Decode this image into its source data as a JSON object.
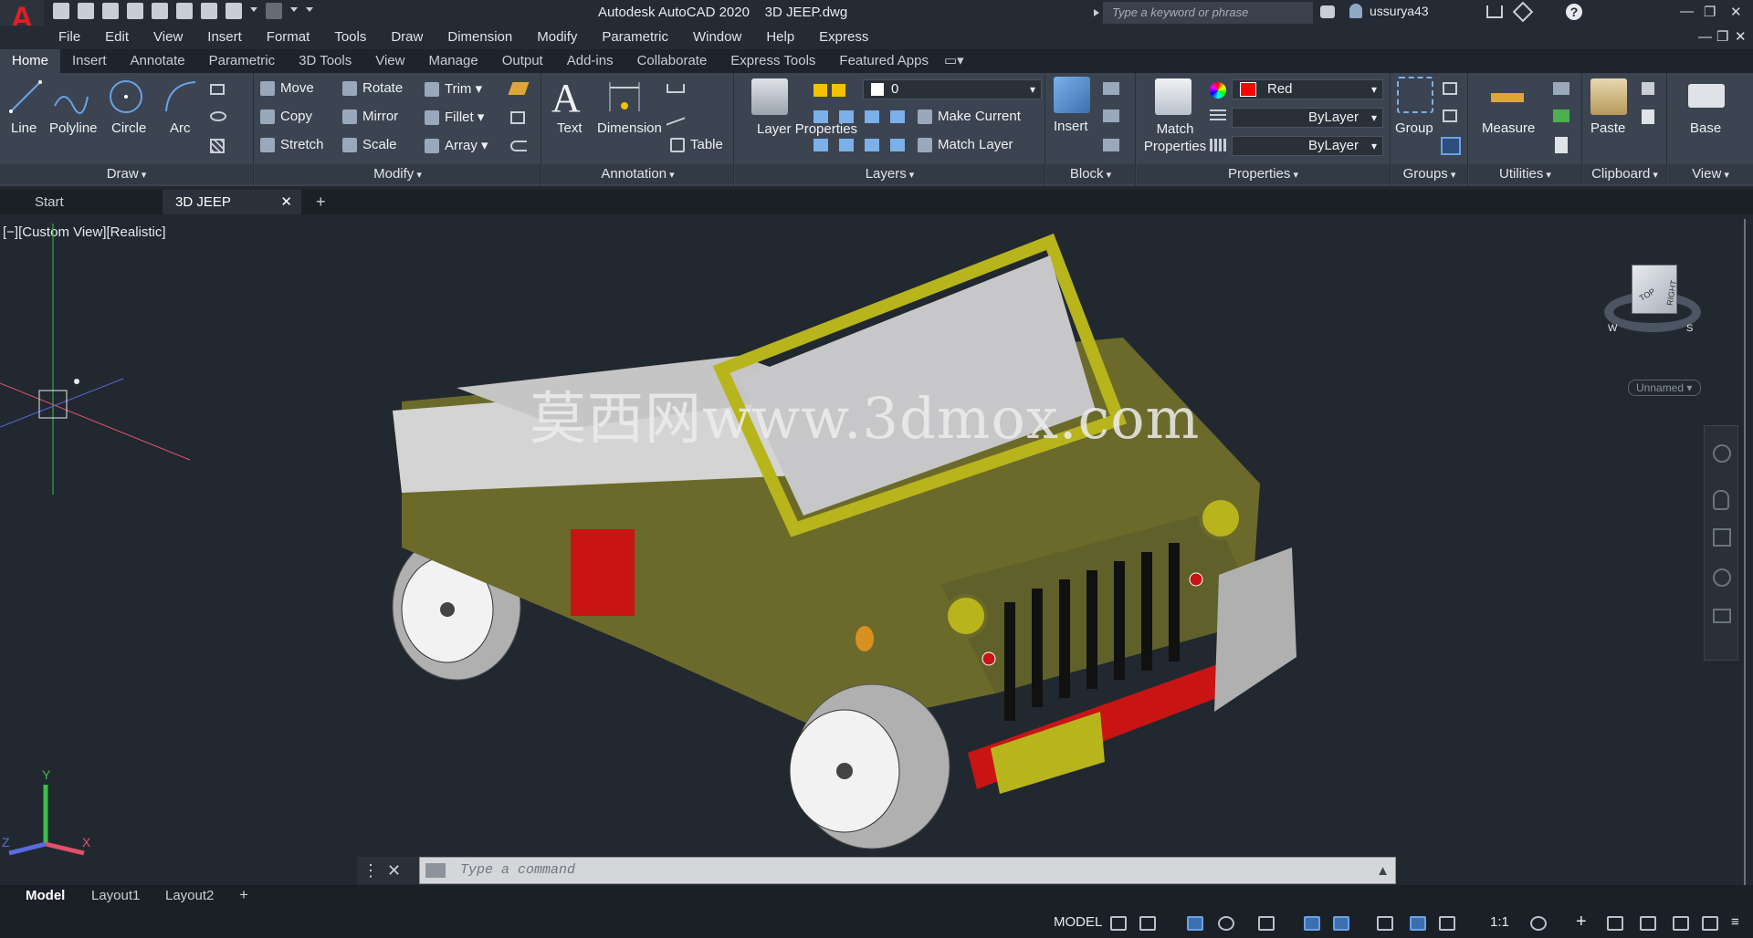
{
  "app": {
    "title": "Autodesk AutoCAD 2020    3D JEEP.dwg",
    "search_placeholder": "Type a keyword or phrase",
    "username": "ussurya43"
  },
  "menu": [
    "File",
    "Edit",
    "View",
    "Insert",
    "Format",
    "Tools",
    "Draw",
    "Dimension",
    "Modify",
    "Parametric",
    "Window",
    "Help",
    "Express"
  ],
  "ribbon_tabs": [
    "Home",
    "Insert",
    "Annotate",
    "Parametric",
    "3D Tools",
    "View",
    "Manage",
    "Output",
    "Add-ins",
    "Collaborate",
    "Express Tools",
    "Featured Apps"
  ],
  "active_ribbon_tab": "Home",
  "panels": {
    "draw": {
      "title": "Draw",
      "tools": [
        "Line",
        "Polyline",
        "Circle",
        "Arc"
      ]
    },
    "modify": {
      "title": "Modify",
      "tools": [
        "Move",
        "Rotate",
        "Trim",
        "Copy",
        "Mirror",
        "Fillet",
        "Stretch",
        "Scale",
        "Array"
      ]
    },
    "annotation": {
      "title": "Annotation",
      "tools": [
        "Text",
        "Dimension",
        "Table"
      ]
    },
    "layers": {
      "title": "Layers",
      "layer_props": "Layer Properties",
      "current_layer": "0",
      "make_current": "Make Current",
      "match_layer": "Match Layer"
    },
    "block": {
      "title": "Block",
      "insert": "Insert"
    },
    "properties": {
      "title": "Properties",
      "match": "Match Properties",
      "color": "Red",
      "color_hex": "#ff0000",
      "linetype": "ByLayer",
      "lineweight": "ByLayer"
    },
    "groups": {
      "title": "Groups",
      "group": "Group"
    },
    "utilities": {
      "title": "Utilities",
      "measure": "Measure"
    },
    "clipboard": {
      "title": "Clipboard",
      "paste": "Paste"
    },
    "view": {
      "title": "View",
      "base": "Base"
    }
  },
  "doc_tabs": [
    "Start",
    "3D JEEP"
  ],
  "viewport": {
    "label": "[−][Custom View][Realistic]",
    "viewcube": {
      "top": "TOP",
      "right": "RIGHT",
      "s": "S",
      "w": "W"
    },
    "view_name": "Unnamed",
    "watermark": "莫西网www.3dmox.com",
    "ucs": {
      "x": "X",
      "y": "Y",
      "z": "Z"
    }
  },
  "command": {
    "placeholder": "Type a command"
  },
  "layout_tabs": [
    "Model",
    "Layout1",
    "Layout2"
  ],
  "status": {
    "space": "MODEL",
    "scale": "1:1"
  },
  "colors": {
    "accent": "#3d6fb0",
    "jeep_body": "#6b6a2a",
    "jeep_frame": "#b8b41c",
    "red": "#c91414",
    "canvas": "#212830"
  }
}
